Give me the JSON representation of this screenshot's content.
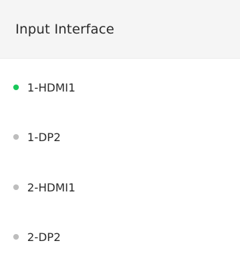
{
  "header": {
    "title": "Input Interface"
  },
  "colors": {
    "active": "#19c75a",
    "inactive": "#bdbdbd"
  },
  "inputs": [
    {
      "label": "1-HDMI1",
      "status": "active"
    },
    {
      "label": "1-DP2",
      "status": "inactive"
    },
    {
      "label": "2-HDMI1",
      "status": "inactive"
    },
    {
      "label": "2-DP2",
      "status": "inactive"
    }
  ]
}
